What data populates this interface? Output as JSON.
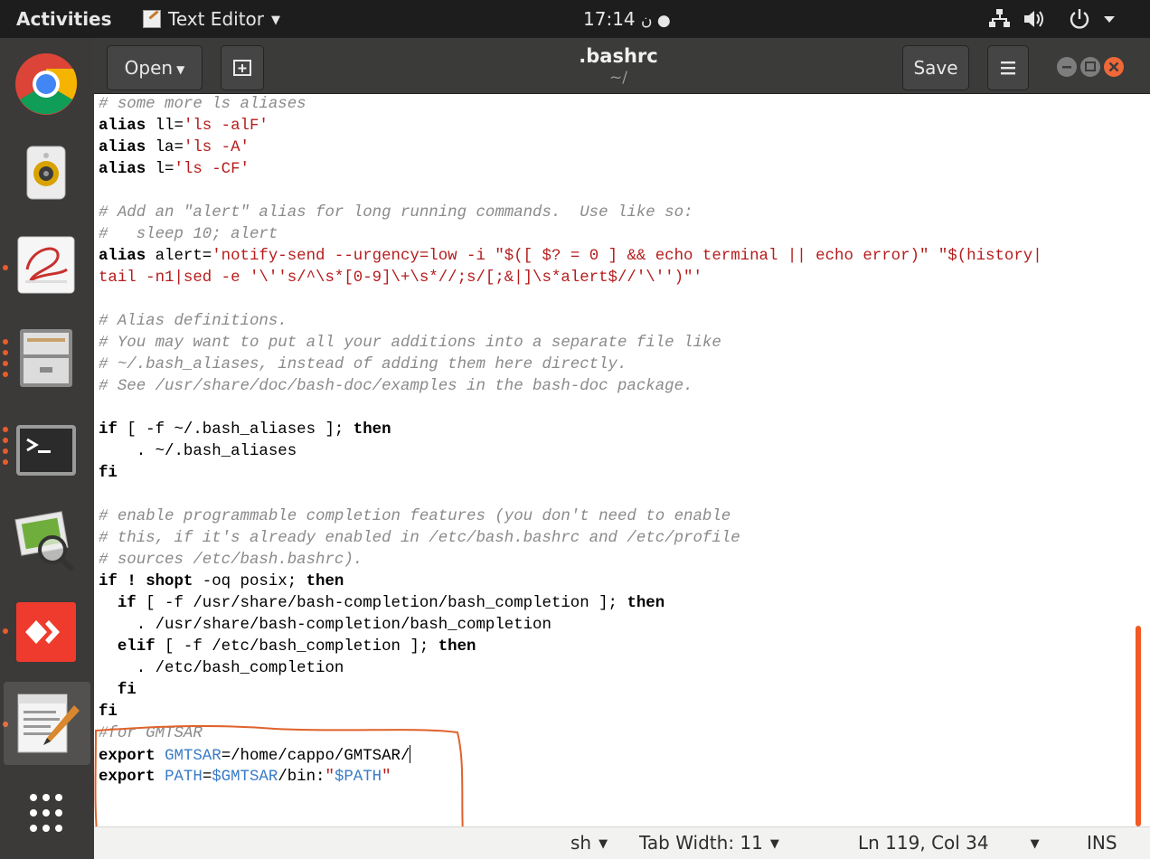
{
  "topbar": {
    "activities": "Activities",
    "app_menu": "Text Editor",
    "clock": "17:14",
    "clock_suffix": "ن ●"
  },
  "launcher": {
    "items": [
      "chrome",
      "speaker-app",
      "document-viewer",
      "files",
      "terminal",
      "image-viewer",
      "anydesk",
      "text-editor",
      "show-applications"
    ]
  },
  "headerbar": {
    "open_label": "Open",
    "title": ".bashrc",
    "subtitle": "~/",
    "save_label": "Save"
  },
  "editor": {
    "lines": [
      "# some more ls aliases",
      "alias ll='ls -alF'",
      "alias la='ls -A'",
      "alias l='ls -CF'",
      "",
      "# Add an \"alert\" alias for long running commands.  Use like so:",
      "#   sleep 10; alert",
      "alias alert='notify-send --urgency=low -i \"$([ $? = 0 ] && echo terminal || echo error)\" \"$(history|",
      "tail -n1|sed -e '\\''s/^\\s*[0-9]\\+\\s*//;s/[;&|]\\s*alert$//'\\'')\"'",
      "",
      "# Alias definitions.",
      "# You may want to put all your additions into a separate file like",
      "# ~/.bash_aliases, instead of adding them here directly.",
      "# See /usr/share/doc/bash-doc/examples in the bash-doc package.",
      "",
      "if [ -f ~/.bash_aliases ]; then",
      "    . ~/.bash_aliases",
      "fi",
      "",
      "# enable programmable completion features (you don't need to enable",
      "# this, if it's already enabled in /etc/bash.bashrc and /etc/profile",
      "# sources /etc/bash.bashrc).",
      "if ! shopt -oq posix; then",
      "  if [ -f /usr/share/bash-completion/bash_completion ]; then",
      "    . /usr/share/bash-completion/bash_completion",
      "  elif [ -f /etc/bash_completion ]; then",
      "    . /etc/bash_completion",
      "  fi",
      "fi",
      "#for GMTSAR",
      "export GMTSAR=/home/cappo/GMTSAR/",
      "export PATH=$GMTSAR/bin:\"$PATH\""
    ]
  },
  "statusbar": {
    "language": "sh",
    "tab_width": "Tab Width: 11",
    "position": "Ln 119, Col 34",
    "mode": "INS"
  },
  "colors": {
    "accent": "#f05a24",
    "annotation": "#e0622a",
    "comment": "#8a8a8a",
    "string": "#b71c1c",
    "variable": "#3a7bc6"
  }
}
